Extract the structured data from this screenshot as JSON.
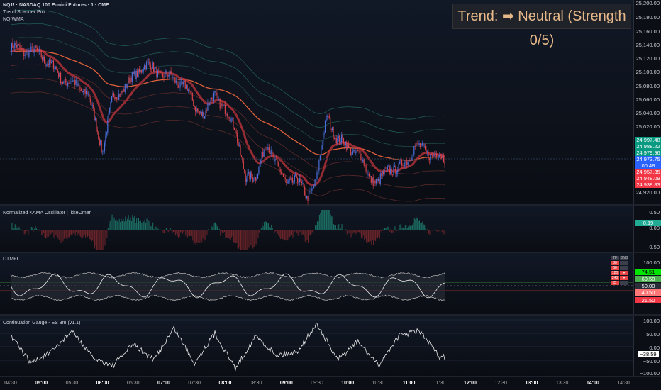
{
  "header": {
    "symbol_line": "NQ1! · NASDAQ 100 E-mini Futures · 1 · CME",
    "indicator1": "Trend Scanner Pro",
    "indicator2": "NQ WMA",
    "trend_label": "Trend: ➡ Neutral (Strength 0/5)"
  },
  "price_axis": {
    "ticks": [
      "25,200.00",
      "25,180.00",
      "25,160.00",
      "25,140.00",
      "25,120.00",
      "25,100.00",
      "25,080.00",
      "25,060.00",
      "25,040.00",
      "25,020.00",
      "24,920.00"
    ],
    "tags": [
      {
        "text": "24,997.48",
        "color": "#089981"
      },
      {
        "text": "24,988.22",
        "color": "#089981"
      },
      {
        "text": "24,979.96",
        "color": "#089981"
      },
      {
        "text": "24,973.75",
        "color": "#2962ff"
      },
      {
        "text": "00:48",
        "color": "#2962ff"
      },
      {
        "text": "24,957.35",
        "color": "#f23645"
      },
      {
        "text": "24,948.09",
        "color": "#f23645"
      },
      {
        "text": "24,938.83",
        "color": "#f23645"
      }
    ]
  },
  "oscillator": {
    "title": "Normalized KAMA Oscillator | IkkeOmar",
    "ticks": [
      "0.50",
      "0.00",
      "−0.50"
    ],
    "value": "0.19"
  },
  "dtmfi": {
    "title": "DTMFI",
    "ticks": [
      "100.00",
      "50.00"
    ],
    "tags": [
      {
        "text": "74.51",
        "color": "#00e600"
      },
      {
        "text": "69.50",
        "color": "#4caf50"
      },
      {
        "text": "50.00",
        "color": "#2a2e39"
      },
      {
        "text": "40.50",
        "color": "#f77"
      },
      {
        "text": "21.50",
        "color": "#f23645"
      }
    ],
    "table": {
      "headers": [
        "TF",
        "DND"
      ],
      "rows": [
        [
          "30",
          ""
        ],
        [
          "60",
          ""
        ],
        [
          "120",
          "▼"
        ],
        [
          "240",
          "▼"
        ],
        [
          "D",
          ""
        ]
      ]
    }
  },
  "gauge": {
    "title": "Continuation Gauge - ES 3m (v1.1)",
    "ticks": [
      "100.00",
      "50.00",
      "0.00",
      "−50.00",
      "−100.00"
    ],
    "value": "−38.59"
  },
  "time_axis": [
    {
      "t": "04:30",
      "b": false
    },
    {
      "t": "05:00",
      "b": true
    },
    {
      "t": "05:30",
      "b": false
    },
    {
      "t": "06:00",
      "b": true
    },
    {
      "t": "06:30",
      "b": false
    },
    {
      "t": "07:00",
      "b": true
    },
    {
      "t": "07:30",
      "b": false
    },
    {
      "t": "08:00",
      "b": true
    },
    {
      "t": "08:30",
      "b": false
    },
    {
      "t": "09:00",
      "b": true
    },
    {
      "t": "09:30",
      "b": false
    },
    {
      "t": "10:00",
      "b": true
    },
    {
      "t": "10:30",
      "b": false
    },
    {
      "t": "11:00",
      "b": true
    },
    {
      "t": "11:30",
      "b": false
    },
    {
      "t": "12:00",
      "b": true
    },
    {
      "t": "12:30",
      "b": false
    },
    {
      "t": "13:00",
      "b": true
    },
    {
      "t": "13:30",
      "b": false
    },
    {
      "t": "14:00",
      "b": true
    },
    {
      "t": "14:30",
      "b": false
    }
  ],
  "chart_data": {
    "type": "line",
    "x_unit": "minutes since 04:30",
    "price": {
      "x": [
        0,
        30,
        50,
        75,
        90,
        100,
        120,
        130,
        150,
        170,
        180,
        190,
        200,
        210,
        220,
        230,
        240,
        250,
        260,
        270,
        280,
        290,
        300,
        310,
        320,
        340,
        350,
        360,
        370,
        380,
        390,
        395,
        425
      ],
      "y": [
        25135,
        25125,
        25090,
        25070,
        24985,
        25060,
        25090,
        25110,
        25095,
        25080,
        25050,
        25035,
        25070,
        25040,
        25020,
        24940,
        24950,
        24990,
        24970,
        24930,
        24950,
        24910,
        24950,
        25035,
        25000,
        24980,
        24950,
        24935,
        24960,
        24955,
        24975,
        24990,
        24972
      ]
    },
    "gauge": {
      "x": [
        0,
        20,
        40,
        60,
        80,
        100,
        120,
        140,
        160,
        180,
        200,
        220,
        240,
        260,
        280,
        300,
        320,
        340,
        360,
        380,
        400,
        420
      ],
      "y": [
        40,
        -60,
        -20,
        60,
        -40,
        -70,
        10,
        -50,
        70,
        -60,
        50,
        -80,
        40,
        -30,
        -20,
        85,
        -50,
        20,
        -70,
        40,
        60,
        -38.59
      ]
    }
  }
}
